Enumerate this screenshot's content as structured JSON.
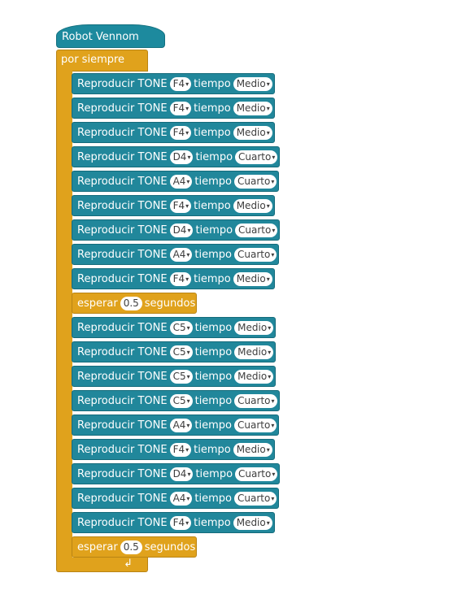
{
  "hat": {
    "label": "Robot Vennom"
  },
  "forever": {
    "label": "por siempre"
  },
  "labels": {
    "play": "Reproducir TONE",
    "time": "tiempo",
    "wait": "esperar",
    "seconds": "segundos",
    "caret": "▾",
    "loop_icon": "↲"
  },
  "blocks": [
    {
      "type": "tone",
      "note": "F4",
      "duration": "Medio"
    },
    {
      "type": "tone",
      "note": "F4",
      "duration": "Medio"
    },
    {
      "type": "tone",
      "note": "F4",
      "duration": "Medio"
    },
    {
      "type": "tone",
      "note": "D4",
      "duration": "Cuarto"
    },
    {
      "type": "tone",
      "note": "A4",
      "duration": "Cuarto"
    },
    {
      "type": "tone",
      "note": "F4",
      "duration": "Medio"
    },
    {
      "type": "tone",
      "note": "D4",
      "duration": "Cuarto"
    },
    {
      "type": "tone",
      "note": "A4",
      "duration": "Cuarto"
    },
    {
      "type": "tone",
      "note": "F4",
      "duration": "Medio"
    },
    {
      "type": "wait",
      "seconds": "0.5"
    },
    {
      "type": "tone",
      "note": "C5",
      "duration": "Medio"
    },
    {
      "type": "tone",
      "note": "C5",
      "duration": "Medio"
    },
    {
      "type": "tone",
      "note": "C5",
      "duration": "Medio"
    },
    {
      "type": "tone",
      "note": "C5",
      "duration": "Cuarto"
    },
    {
      "type": "tone",
      "note": "A4",
      "duration": "Cuarto"
    },
    {
      "type": "tone",
      "note": "F4",
      "duration": "Medio"
    },
    {
      "type": "tone",
      "note": "D4",
      "duration": "Cuarto"
    },
    {
      "type": "tone",
      "note": "A4",
      "duration": "Cuarto"
    },
    {
      "type": "tone",
      "note": "F4",
      "duration": "Medio"
    },
    {
      "type": "wait",
      "seconds": "0.5"
    }
  ],
  "colors": {
    "tone_block": "#21879b",
    "control_block": "#e0a21c",
    "hat_block": "#1d8a9e"
  }
}
